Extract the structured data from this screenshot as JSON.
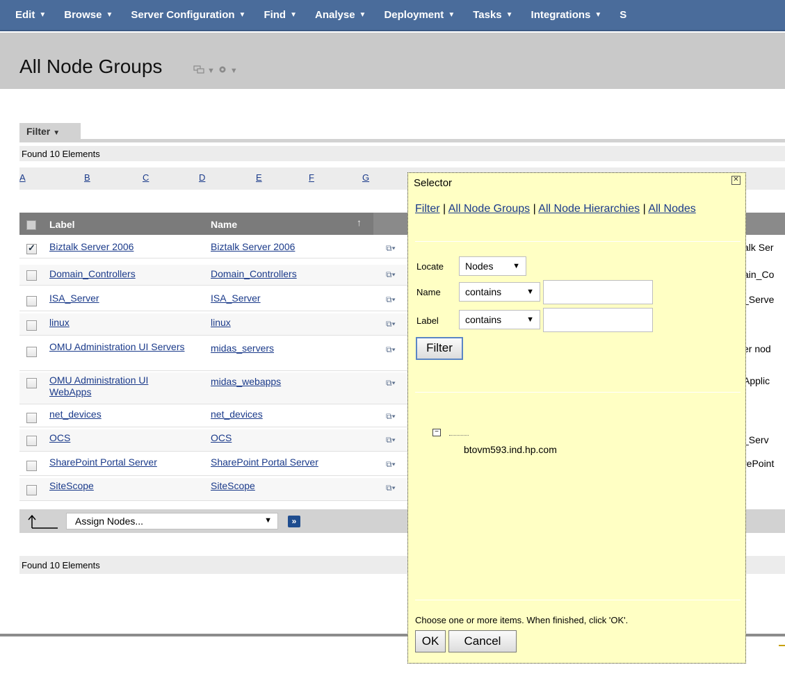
{
  "menubar": {
    "items": [
      {
        "label": "Edit"
      },
      {
        "label": "Browse"
      },
      {
        "label": "Server Configuration"
      },
      {
        "label": "Find"
      },
      {
        "label": "Analyse"
      },
      {
        "label": "Deployment"
      },
      {
        "label": "Tasks"
      },
      {
        "label": "Integrations"
      },
      {
        "label": "S"
      }
    ]
  },
  "page": {
    "title": "All Node Groups"
  },
  "filter": {
    "tab_label": "Filter"
  },
  "found_top": "Found 10 Elements",
  "found_bottom": "Found 10 Elements",
  "alphabet": [
    "A",
    "B",
    "C",
    "D",
    "E",
    "F",
    "G"
  ],
  "table": {
    "headers": {
      "label": "Label",
      "name": "Name"
    },
    "rows": [
      {
        "label": "Biztalk Server 2006",
        "name": "Biztalk Server 2006",
        "checked": true,
        "desc": "alk Ser"
      },
      {
        "label": "Domain_Controllers",
        "name": "Domain_Controllers",
        "checked": false,
        "desc": "ain_Co"
      },
      {
        "label": "ISA_Server",
        "name": "ISA_Server",
        "checked": false,
        "desc": "_Serve"
      },
      {
        "label": "linux",
        "name": "linux",
        "checked": false,
        "desc": ""
      },
      {
        "label": "OMU Administration UI Servers",
        "name": "midas_servers",
        "checked": false,
        "desc": "er nod"
      },
      {
        "label": "OMU Administration UI WebApps",
        "name": "midas_webapps",
        "checked": false,
        "desc": "Applic"
      },
      {
        "label": "net_devices",
        "name": "net_devices",
        "checked": false,
        "desc": ""
      },
      {
        "label": "OCS",
        "name": "OCS",
        "checked": false,
        "desc": "_Serv"
      },
      {
        "label": "SharePoint Portal Server",
        "name": "SharePoint Portal Server",
        "checked": false,
        "desc": "rePoint"
      },
      {
        "label": "SiteScope",
        "name": "SiteScope",
        "checked": false,
        "desc": ""
      }
    ]
  },
  "actions": {
    "assign_label": "Assign Nodes...",
    "go_label": "»"
  },
  "selector": {
    "title": "Selector",
    "links": {
      "filter": "Filter",
      "groups": "All Node Groups",
      "hierarchies": "All Node Hierarchies",
      "nodes": "All Nodes",
      "separator": "|"
    },
    "locate_label": "Locate",
    "locate_value": "Nodes",
    "name_label": "Name",
    "name_op": "contains",
    "label_label": "Label",
    "label_op": "contains",
    "filter_button": "Filter",
    "tree_node": "btovm593.ind.hp.com",
    "hint": "Choose one or more items. When finished, click 'OK'.",
    "ok_button": "OK",
    "cancel_button": "Cancel"
  },
  "colors": {
    "menubar": "#4a6c9b",
    "selector_bg": "#ffffc4",
    "link": "#1a3a8a"
  }
}
